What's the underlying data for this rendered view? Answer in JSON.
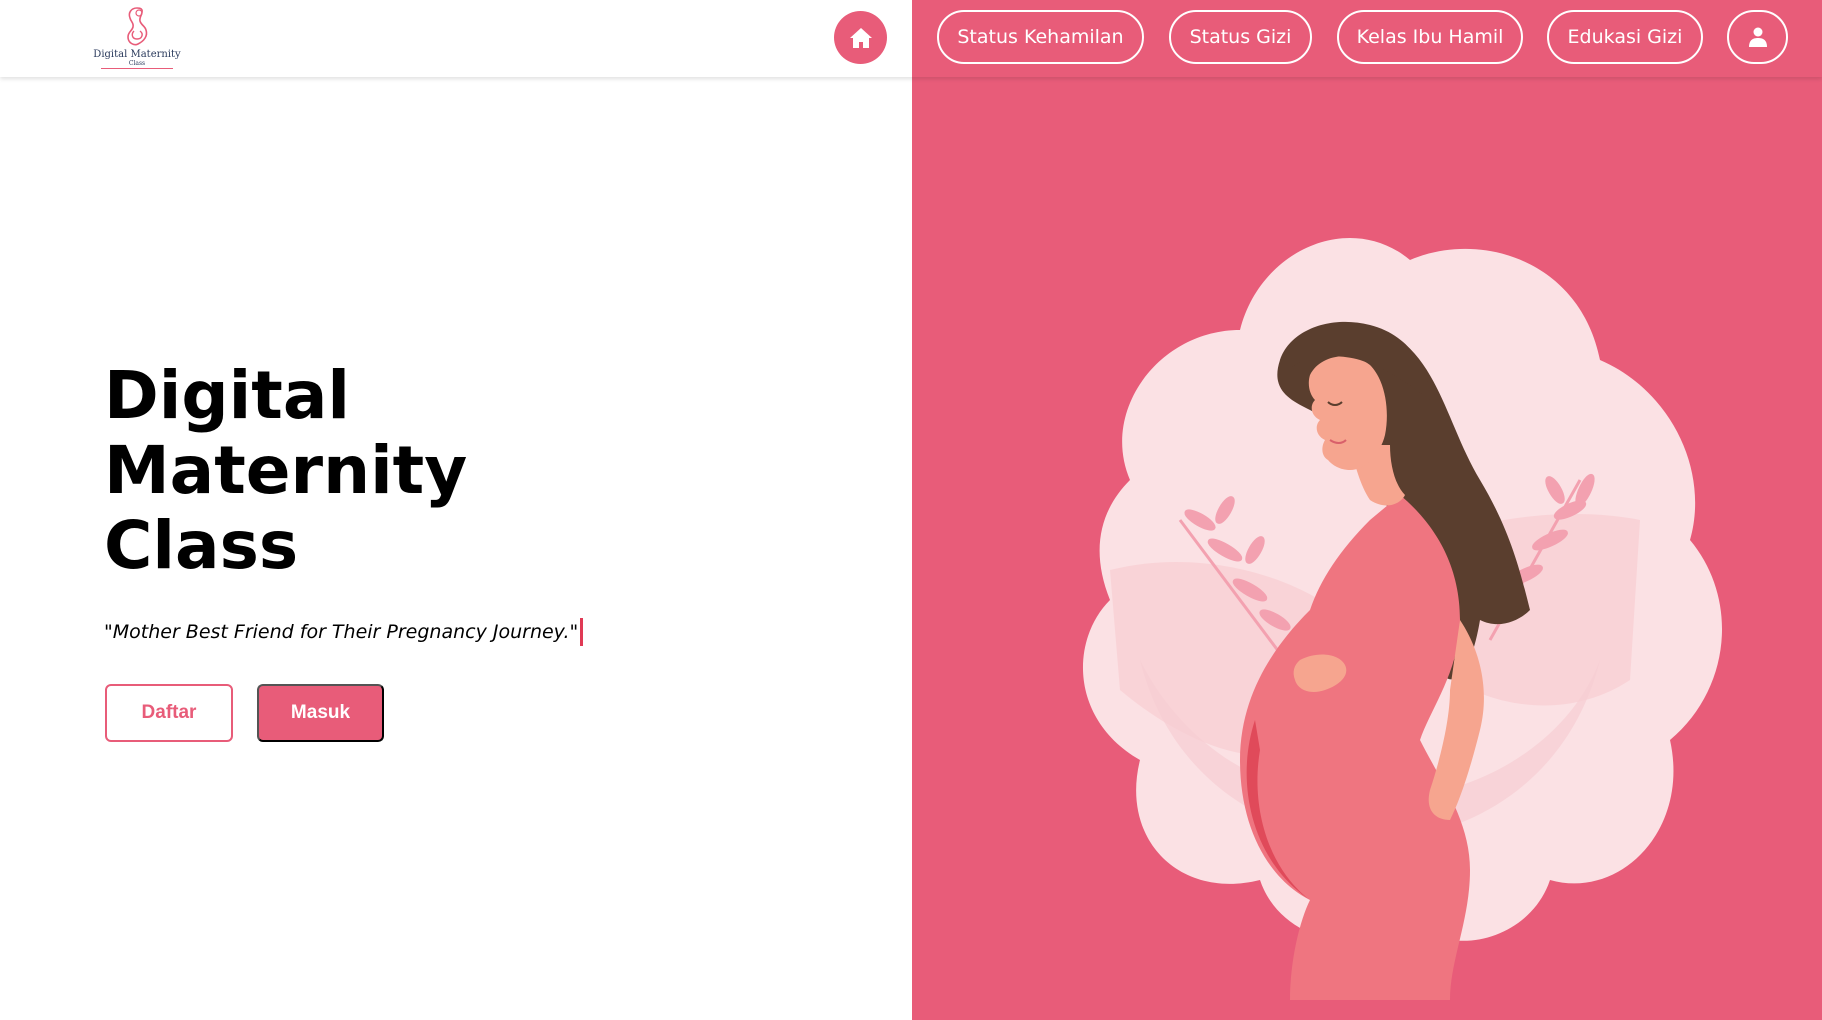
{
  "brand": {
    "logo_line1": "Digital Maternity",
    "logo_line2": "Class"
  },
  "nav": {
    "home_icon": "home-icon",
    "items": [
      {
        "label": "Status Kehamilan"
      },
      {
        "label": "Status Gizi"
      },
      {
        "label": "Kelas Ibu Hamil"
      },
      {
        "label": "Edukasi Gizi"
      }
    ],
    "user_icon": "user-icon"
  },
  "hero": {
    "title_lines": [
      "Digital",
      "Maternity",
      "Class"
    ],
    "tagline": "\"Mother Best Friend for Their Pregnancy Journey.\"",
    "register_label": "Daftar",
    "login_label": "Masuk"
  },
  "colors": {
    "accent": "#e85c79",
    "accent_dark": "#e03a55",
    "blob": "#fbe1e4",
    "text": "#000000"
  },
  "illustration": "pregnant-woman-illustration"
}
